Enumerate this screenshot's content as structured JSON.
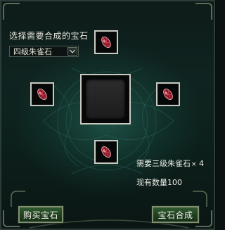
{
  "prompt": "选择需要合成的宝石",
  "gem_select": {
    "selected": "四级朱雀石"
  },
  "slots": {
    "top_icon": "red-gem-icon",
    "left_icon": "red-gem-icon",
    "right_icon": "red-gem-icon",
    "bottom_icon": "red-gem-icon"
  },
  "requirement": {
    "text": "需要三级朱雀石",
    "multiplier": "×",
    "count": "4"
  },
  "quantity": {
    "label": "现有数量",
    "value": "100"
  },
  "buttons": {
    "buy": "购买宝石",
    "craft": "宝石合成"
  },
  "colors": {
    "gem": "#b8263a",
    "button": "#2f5a2f"
  }
}
